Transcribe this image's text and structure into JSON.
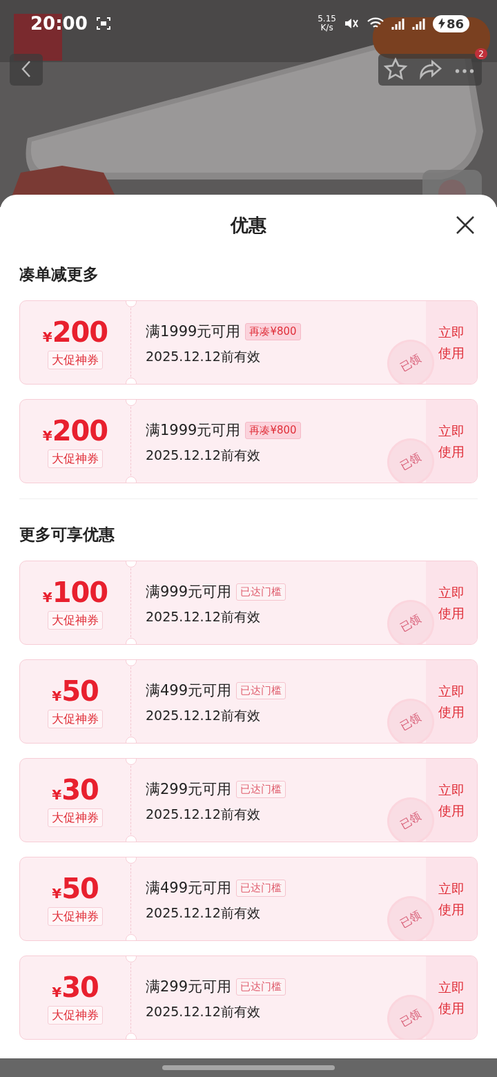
{
  "status_bar": {
    "time": "20:00",
    "speed": "5.15",
    "speed_unit": "K/s",
    "battery": "86"
  },
  "nav": {
    "cart_badge": "2"
  },
  "sheet": {
    "title": "优惠",
    "sections": [
      {
        "title": "凑单减更多",
        "coupons": [
          {
            "currency": "¥",
            "amount": "200",
            "label": "大促神券",
            "condition": "满1999元可用",
            "tag": {
              "kind": "gap",
              "text": "再凑¥800"
            },
            "validity": "2025.12.12前有效",
            "action": "立即使用",
            "stamp": "已领"
          },
          {
            "currency": "¥",
            "amount": "200",
            "label": "大促神券",
            "condition": "满1999元可用",
            "tag": {
              "kind": "gap",
              "text": "再凑¥800"
            },
            "validity": "2025.12.12前有效",
            "action": "立即使用",
            "stamp": "已领"
          }
        ]
      },
      {
        "title": "更多可享优惠",
        "coupons": [
          {
            "currency": "¥",
            "amount": "100",
            "label": "大促神券",
            "condition": "满999元可用",
            "tag": {
              "kind": "reached",
              "text": "已达门槛"
            },
            "validity": "2025.12.12前有效",
            "action": "立即使用",
            "stamp": "已领"
          },
          {
            "currency": "¥",
            "amount": "50",
            "label": "大促神券",
            "condition": "满499元可用",
            "tag": {
              "kind": "reached",
              "text": "已达门槛"
            },
            "validity": "2025.12.12前有效",
            "action": "立即使用",
            "stamp": "已领"
          },
          {
            "currency": "¥",
            "amount": "30",
            "label": "大促神券",
            "condition": "满299元可用",
            "tag": {
              "kind": "reached",
              "text": "已达门槛"
            },
            "validity": "2025.12.12前有效",
            "action": "立即使用",
            "stamp": "已领"
          },
          {
            "currency": "¥",
            "amount": "50",
            "label": "大促神券",
            "condition": "满499元可用",
            "tag": {
              "kind": "reached",
              "text": "已达门槛"
            },
            "validity": "2025.12.12前有效",
            "action": "立即使用",
            "stamp": "已领"
          },
          {
            "currency": "¥",
            "amount": "30",
            "label": "大促神券",
            "condition": "满299元可用",
            "tag": {
              "kind": "reached",
              "text": "已达门槛"
            },
            "validity": "2025.12.12前有效",
            "action": "立即使用",
            "stamp": "已领"
          }
        ]
      }
    ]
  }
}
